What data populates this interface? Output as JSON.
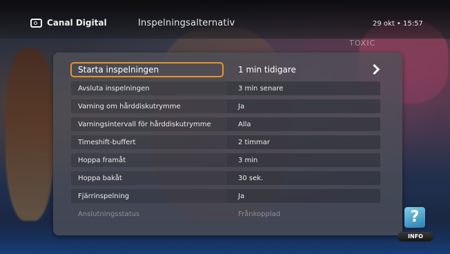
{
  "header": {
    "brand": "Canal Digital",
    "brand_icon": "tv-icon",
    "title": "Inspelningsalternativ",
    "clock": "29 okt • 15:57"
  },
  "background": {
    "channel_logo": "TOXIC"
  },
  "settings": [
    {
      "label": "Starta inspelningen",
      "value": "1 min tidigare",
      "state": "selected"
    },
    {
      "label": "Avsluta inspelningen",
      "value": "3 min senare",
      "state": "normal"
    },
    {
      "label": "Varning om hårddiskutrymme",
      "value": "Ja",
      "state": "normal"
    },
    {
      "label": "Varningsintervall för hårddiskutrymme",
      "value": "Alla",
      "state": "normal"
    },
    {
      "label": "Timeshift-buffert",
      "value": "2 timmar",
      "state": "normal"
    },
    {
      "label": "Hoppa framåt",
      "value": "3 min",
      "state": "normal"
    },
    {
      "label": "Hoppa bakåt",
      "value": "30 sek.",
      "state": "normal"
    },
    {
      "label": "Fjärrinspelning",
      "value": "Ja",
      "state": "normal"
    },
    {
      "label": "Anslutningsstatus",
      "value": "Frånkopplad",
      "state": "disabled"
    }
  ],
  "info": {
    "glyph": "?",
    "label": "INFO"
  },
  "colors": {
    "focus": "#e7962a",
    "panel": "#4e5058",
    "text": "#ececec",
    "disabled_text": "#8e9097"
  }
}
